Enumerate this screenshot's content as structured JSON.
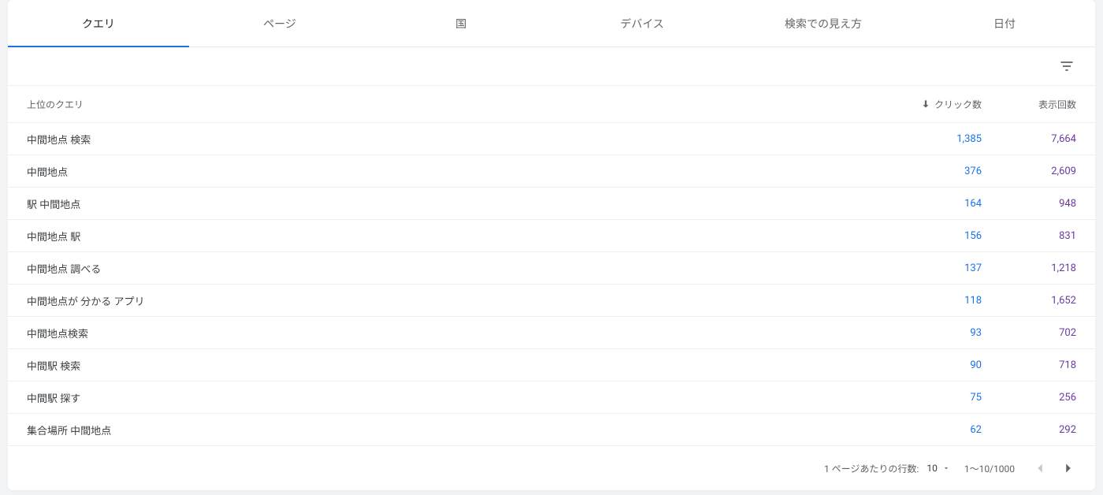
{
  "tabs": [
    {
      "label": "クエリ",
      "active": true
    },
    {
      "label": "ページ",
      "active": false
    },
    {
      "label": "国",
      "active": false
    },
    {
      "label": "デバイス",
      "active": false
    },
    {
      "label": "検索での見え方",
      "active": false
    },
    {
      "label": "日付",
      "active": false
    }
  ],
  "columns": {
    "query": "上位のクエリ",
    "clicks": "クリック数",
    "impressions": "表示回数"
  },
  "rows": [
    {
      "query": "中間地点 検索",
      "clicks": "1,385",
      "impressions": "7,664"
    },
    {
      "query": "中間地点",
      "clicks": "376",
      "impressions": "2,609"
    },
    {
      "query": "駅 中間地点",
      "clicks": "164",
      "impressions": "948"
    },
    {
      "query": "中間地点 駅",
      "clicks": "156",
      "impressions": "831"
    },
    {
      "query": "中間地点 調べる",
      "clicks": "137",
      "impressions": "1,218"
    },
    {
      "query": "中間地点が 分かる アプリ",
      "clicks": "118",
      "impressions": "1,652"
    },
    {
      "query": "中間地点検索",
      "clicks": "93",
      "impressions": "702"
    },
    {
      "query": "中間駅 検索",
      "clicks": "90",
      "impressions": "718"
    },
    {
      "query": "中間駅 探す",
      "clicks": "75",
      "impressions": "256"
    },
    {
      "query": "集合場所 中間地点",
      "clicks": "62",
      "impressions": "292"
    }
  ],
  "footer": {
    "rows_per_page_label": "1 ページあたりの行数:",
    "rows_per_page_value": "10",
    "page_range": "1～10/1000"
  }
}
